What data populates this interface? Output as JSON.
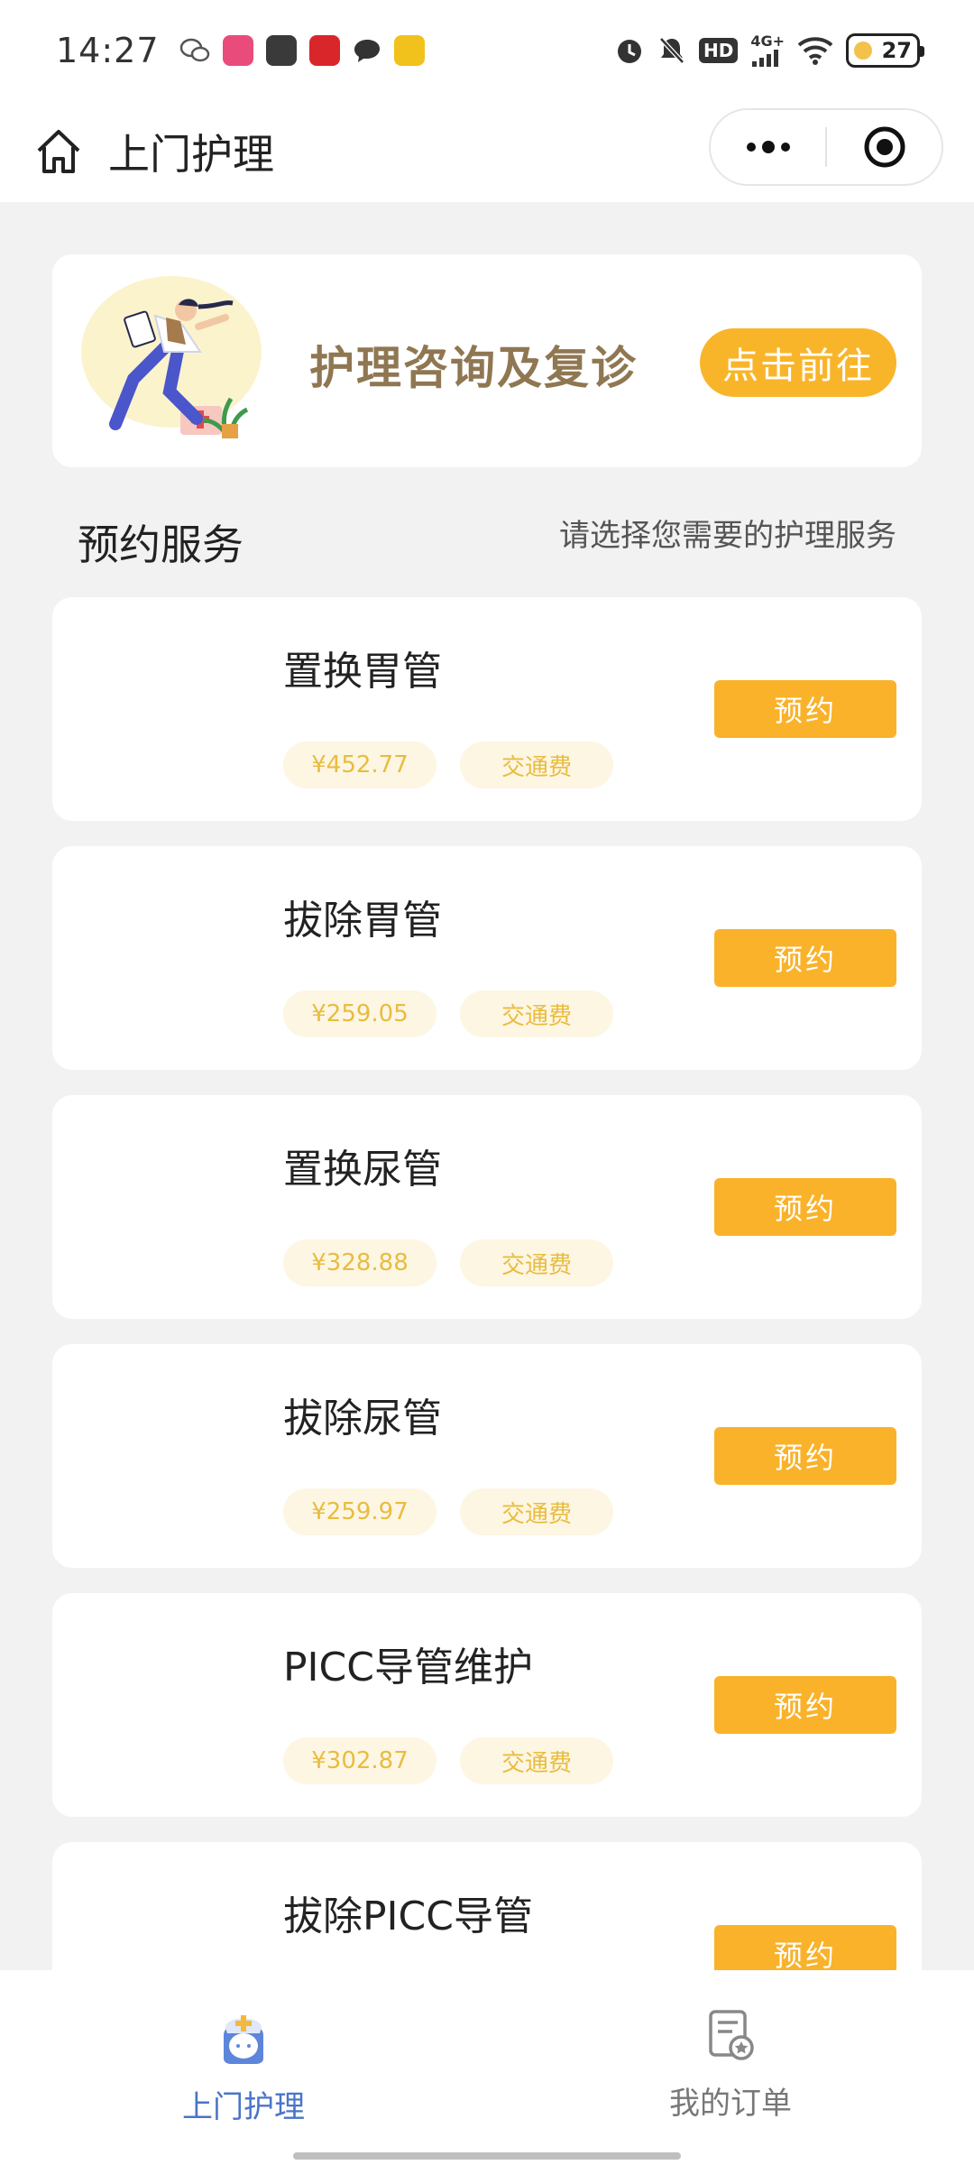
{
  "status_bar": {
    "time": "14:27",
    "network": "4G+",
    "hd": "HD",
    "battery": "27",
    "icons": [
      "wechat-icon",
      "app-icon-pink",
      "app-icon-gray",
      "app-icon-red",
      "message-icon",
      "app-icon-yellow",
      "alarm-icon",
      "mute-icon",
      "hd-icon",
      "signal-icon",
      "wifi-icon",
      "battery-icon"
    ]
  },
  "nav": {
    "title": "上门护理",
    "home_icon": "home-icon",
    "more_icon": "more-icon",
    "close_icon": "target-icon"
  },
  "banner": {
    "title": "护理咨询及复诊",
    "button": "点击前往"
  },
  "section": {
    "title": "预约服务",
    "hint": "请选择您需要的护理服务"
  },
  "services": [
    {
      "name": "置换胃管",
      "price": "¥452.77",
      "fee": "交通费",
      "button": "预约"
    },
    {
      "name": "拔除胃管",
      "price": "¥259.05",
      "fee": "交通费",
      "button": "预约"
    },
    {
      "name": "置换尿管",
      "price": "¥328.88",
      "fee": "交通费",
      "button": "预约"
    },
    {
      "name": "拔除尿管",
      "price": "¥259.97",
      "fee": "交通费",
      "button": "预约"
    },
    {
      "name": "PICC导管维护",
      "price": "¥302.87",
      "fee": "交通费",
      "button": "预约"
    },
    {
      "name": "拔除PICC导管",
      "price": "",
      "fee": "",
      "button": "预约"
    }
  ],
  "tabs": [
    {
      "label": "上门护理",
      "icon": "nurse-icon",
      "active": true
    },
    {
      "label": "我的订单",
      "icon": "order-icon",
      "active": false
    }
  ],
  "colors": {
    "accent": "#f9b22a",
    "banner_title": "#8f7752",
    "tag_text": "#e9bc3f",
    "tag_bg": "#fdf6e3",
    "active_tab": "#4a74c9"
  }
}
